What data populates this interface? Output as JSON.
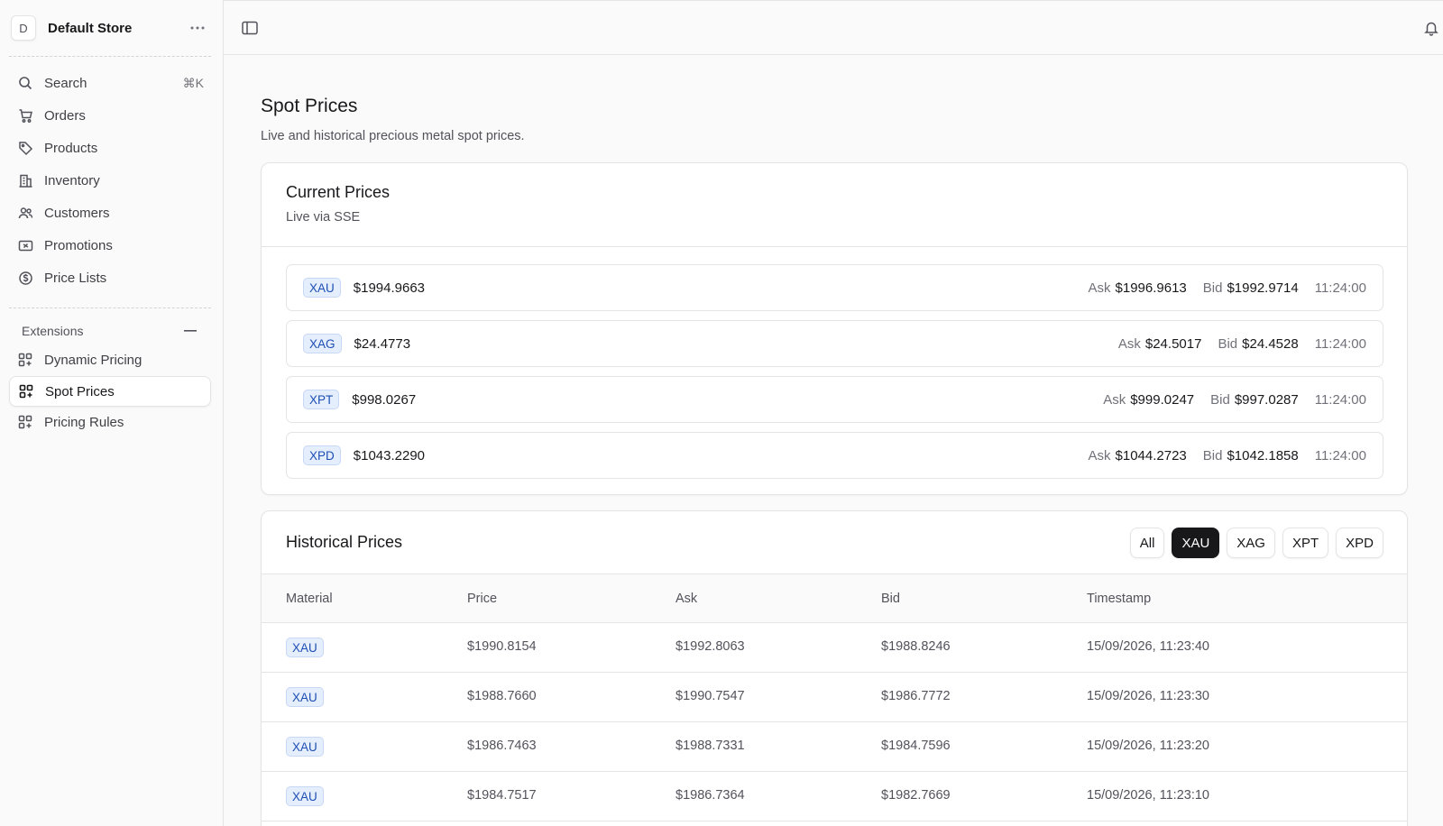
{
  "store": {
    "avatar_letter": "D",
    "name": "Default Store"
  },
  "nav": {
    "search": {
      "label": "Search",
      "shortcut": "⌘K"
    },
    "items": [
      {
        "label": "Orders",
        "icon": "cart-icon"
      },
      {
        "label": "Products",
        "icon": "tag-icon"
      },
      {
        "label": "Inventory",
        "icon": "building-icon"
      },
      {
        "label": "Customers",
        "icon": "users-icon"
      },
      {
        "label": "Promotions",
        "icon": "ticket-icon"
      },
      {
        "label": "Price Lists",
        "icon": "dollar-circle-icon"
      }
    ],
    "extensions": {
      "title": "Extensions",
      "items": [
        {
          "label": "Dynamic Pricing",
          "icon": "grid-plus-icon",
          "active": false
        },
        {
          "label": "Spot Prices",
          "icon": "grid-plus-icon",
          "active": true
        },
        {
          "label": "Pricing Rules",
          "icon": "grid-plus-icon",
          "active": false
        }
      ]
    }
  },
  "page": {
    "title": "Spot Prices",
    "subtitle": "Live and historical precious metal spot prices."
  },
  "current": {
    "title": "Current Prices",
    "subtitle": "Live via SSE",
    "ask_label": "Ask",
    "bid_label": "Bid",
    "rows": [
      {
        "code": "XAU",
        "price": "$1994.9663",
        "ask": "$1996.9613",
        "bid": "$1992.9714",
        "time": "11:24:00"
      },
      {
        "code": "XAG",
        "price": "$24.4773",
        "ask": "$24.5017",
        "bid": "$24.4528",
        "time": "11:24:00"
      },
      {
        "code": "XPT",
        "price": "$998.0267",
        "ask": "$999.0247",
        "bid": "$997.0287",
        "time": "11:24:00"
      },
      {
        "code": "XPD",
        "price": "$1043.2290",
        "ask": "$1044.2723",
        "bid": "$1042.1858",
        "time": "11:24:00"
      }
    ]
  },
  "historical": {
    "title": "Historical Prices",
    "filters": [
      "All",
      "XAU",
      "XAG",
      "XPT",
      "XPD"
    ],
    "active_filter": "XAU",
    "columns": [
      "Material",
      "Price",
      "Ask",
      "Bid",
      "Timestamp"
    ],
    "rows": [
      {
        "material": "XAU",
        "price": "$1990.8154",
        "ask": "$1992.8063",
        "bid": "$1988.8246",
        "timestamp": "15/09/2026, 11:23:40"
      },
      {
        "material": "XAU",
        "price": "$1988.7660",
        "ask": "$1990.7547",
        "bid": "$1986.7772",
        "timestamp": "15/09/2026, 11:23:30"
      },
      {
        "material": "XAU",
        "price": "$1986.7463",
        "ask": "$1988.7331",
        "bid": "$1984.7596",
        "timestamp": "15/09/2026, 11:23:20"
      },
      {
        "material": "XAU",
        "price": "$1984.7517",
        "ask": "$1986.7364",
        "bid": "$1982.7669",
        "timestamp": "15/09/2026, 11:23:10"
      }
    ]
  },
  "colors": {
    "accent": "#18181b",
    "badge_bg": "#e5eefc",
    "badge_text": "#1e4fb4"
  }
}
